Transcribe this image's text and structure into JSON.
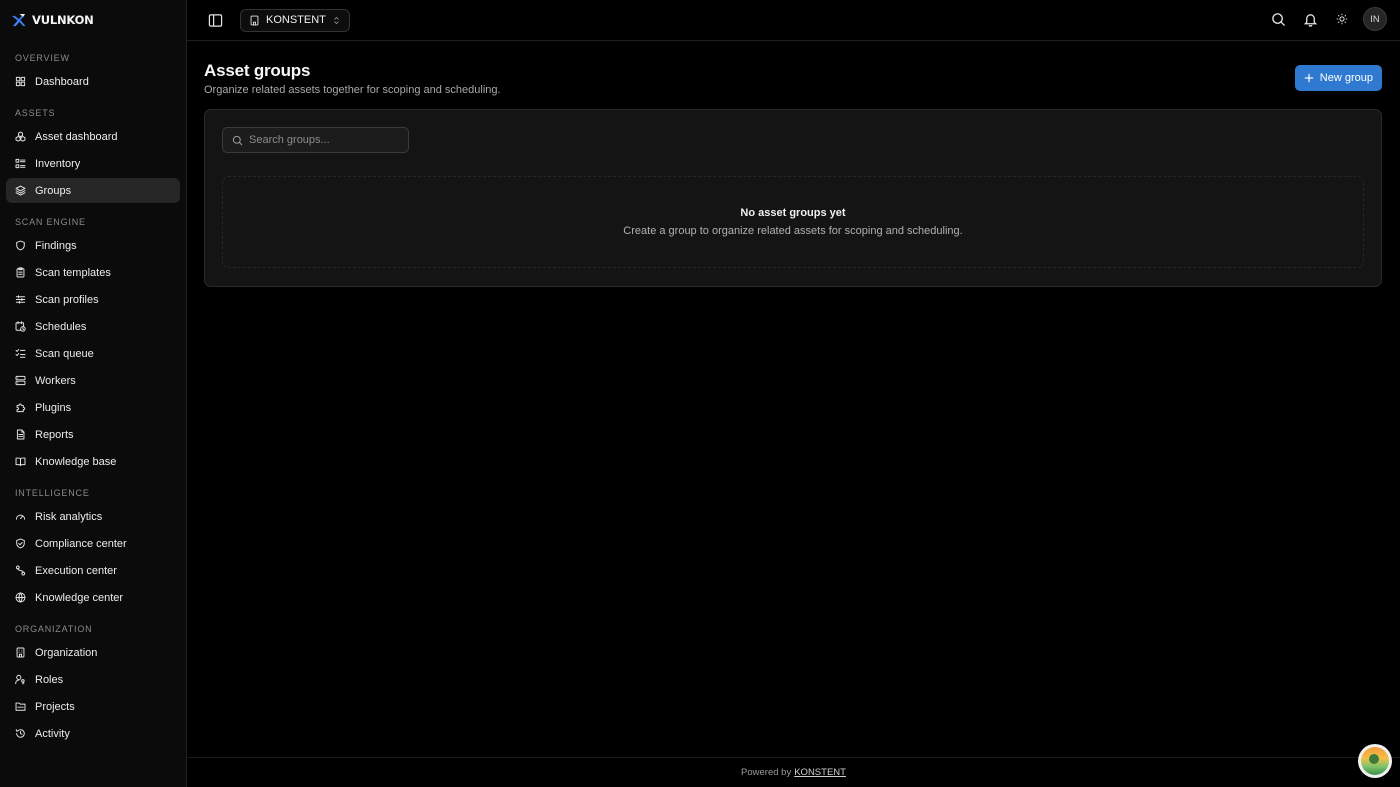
{
  "brand": {
    "name": "VULNKON",
    "accent": "#3b82f6"
  },
  "sidebar": {
    "sections": [
      {
        "label": "OVERVIEW",
        "items": [
          {
            "label": "Dashboard",
            "icon": "grid-icon"
          }
        ]
      },
      {
        "label": "ASSETS",
        "items": [
          {
            "label": "Asset dashboard",
            "icon": "boxes-icon"
          },
          {
            "label": "Inventory",
            "icon": "list-icon"
          },
          {
            "label": "Groups",
            "icon": "layers-icon",
            "active": true
          }
        ]
      },
      {
        "label": "SCAN ENGINE",
        "items": [
          {
            "label": "Findings",
            "icon": "shield-icon"
          },
          {
            "label": "Scan templates",
            "icon": "clipboard-icon"
          },
          {
            "label": "Scan profiles",
            "icon": "sliders-icon"
          },
          {
            "label": "Schedules",
            "icon": "calendar-clock-icon"
          },
          {
            "label": "Scan queue",
            "icon": "list-checks-icon"
          },
          {
            "label": "Workers",
            "icon": "server-icon"
          },
          {
            "label": "Plugins",
            "icon": "puzzle-icon"
          },
          {
            "label": "Reports",
            "icon": "file-text-icon"
          },
          {
            "label": "Knowledge base",
            "icon": "book-icon"
          }
        ]
      },
      {
        "label": "INTELLIGENCE",
        "items": [
          {
            "label": "Risk analytics",
            "icon": "gauge-icon"
          },
          {
            "label": "Compliance center",
            "icon": "shield-check-icon"
          },
          {
            "label": "Execution center",
            "icon": "route-icon"
          },
          {
            "label": "Knowledge center",
            "icon": "globe-icon"
          }
        ]
      },
      {
        "label": "ORGANIZATION",
        "items": [
          {
            "label": "Organization",
            "icon": "building-icon"
          },
          {
            "label": "Roles",
            "icon": "user-key-icon"
          },
          {
            "label": "Projects",
            "icon": "folder-icon"
          },
          {
            "label": "Activity",
            "icon": "history-icon"
          }
        ]
      }
    ]
  },
  "topbar": {
    "org_name": "KONSTENT",
    "avatar_initials": "IN"
  },
  "page": {
    "title": "Asset groups",
    "subtitle": "Organize related assets together for scoping and scheduling.",
    "new_button_label": "New group",
    "search_placeholder": "Search groups...",
    "empty_title": "No asset groups yet",
    "empty_description": "Create a group to organize related assets for scoping and scheduling."
  },
  "footer": {
    "prefix": "Powered by",
    "link": "KONSTENT"
  },
  "colors": {
    "background": "#000000",
    "sidebar": "#0b0b0b",
    "card": "#141414",
    "primary": "#2f7ad0",
    "active_nav": "#262626"
  }
}
